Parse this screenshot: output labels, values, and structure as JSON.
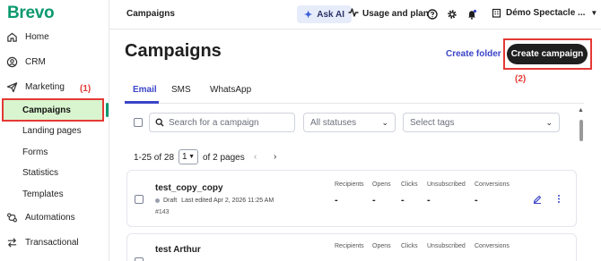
{
  "sidebar": {
    "logo": "Brevo",
    "items": [
      {
        "label": "Home",
        "icon": "home-icon"
      },
      {
        "label": "CRM",
        "icon": "contacts-icon"
      },
      {
        "label": "Marketing",
        "icon": "send-icon"
      },
      {
        "label": "Automations",
        "icon": "automation-icon"
      },
      {
        "label": "Transactional",
        "icon": "transactional-icon"
      }
    ],
    "marketing_sub": {
      "active": "Campaigns",
      "items": [
        "Landing pages",
        "Forms",
        "Statistics",
        "Templates"
      ]
    },
    "annotation": "(1)"
  },
  "topbar": {
    "title": "Campaigns",
    "ask_ai": "Ask AI",
    "usage": "Usage and plan",
    "account": "Démo Spectacle ..."
  },
  "header": {
    "title": "Campaigns",
    "create_folder": "Create folder",
    "create_campaign": "Create campaign",
    "annotation": "(2)"
  },
  "tabs": [
    {
      "label": "Email",
      "active": true
    },
    {
      "label": "SMS",
      "active": false
    },
    {
      "label": "WhatsApp",
      "active": false
    }
  ],
  "filters": {
    "search_placeholder": "Search for a campaign",
    "status_select": "All statuses",
    "tags_select": "Select tags"
  },
  "pagination": {
    "range": "1-25 of 28",
    "page": "1",
    "pages": "of 2 pages"
  },
  "columns": [
    "Recipients",
    "Opens",
    "Clicks",
    "Unsubscribed",
    "Conversions"
  ],
  "campaigns": [
    {
      "name": "test_copy_copy",
      "status": "Draft",
      "edited": "Last edited Apr 2, 2026 11:25 AM",
      "id": "#143",
      "values": [
        "-",
        "-",
        "-",
        "-",
        "-"
      ]
    },
    {
      "name": "test Arthur",
      "status": "",
      "edited": "",
      "id": "",
      "values": [
        "",
        "",
        "",
        "",
        ""
      ]
    }
  ],
  "colors": {
    "brand": "#0b996e",
    "accent": "#3a44c7",
    "annotation": "#e53935",
    "active_bg": "#d8f5cf"
  }
}
